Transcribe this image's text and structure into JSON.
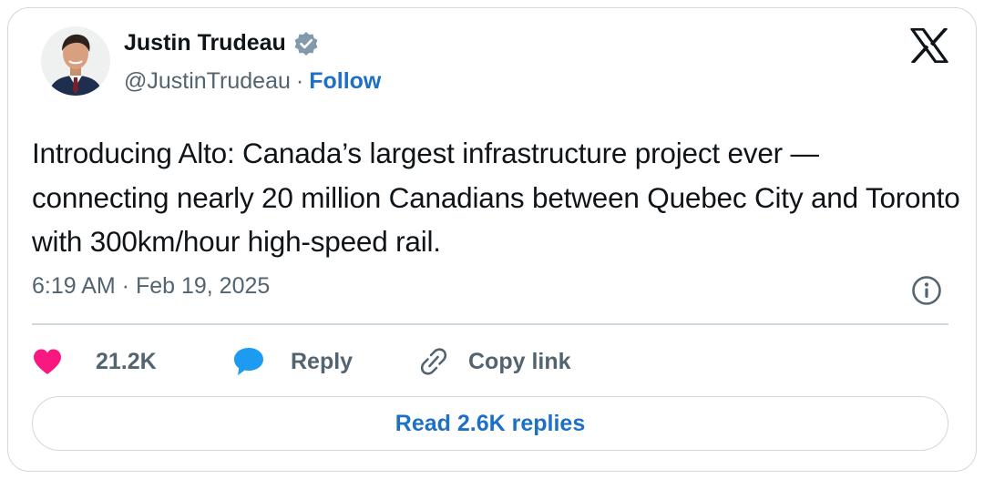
{
  "author": {
    "name": "Justin Trudeau",
    "handle": "@JustinTrudeau",
    "separator": "·",
    "follow_label": "Follow"
  },
  "tweet": {
    "text": "Introducing Alto: Canada’s largest infrastructure project ever — connecting nearly 20 million Canadians between Quebec City and Toronto with 300km/hour high-speed rail.",
    "timestamp": "6:19 AM · Feb 19, 2025"
  },
  "actions": {
    "like_count": "21.2K",
    "reply_label": "Reply",
    "copy_link_label": "Copy link"
  },
  "read_replies_label": "Read 2.6K replies",
  "colors": {
    "text": "#0f1419",
    "secondary": "#536471",
    "link": "#1d70c8",
    "like": "#f91880",
    "reply": "#1d9bf0",
    "border": "#cfd9de",
    "verified": "#829aab"
  },
  "icons": [
    "avatar",
    "verified-badge-icon",
    "x-logo-icon",
    "info-icon",
    "heart-icon",
    "reply-bubble-icon",
    "link-icon"
  ]
}
